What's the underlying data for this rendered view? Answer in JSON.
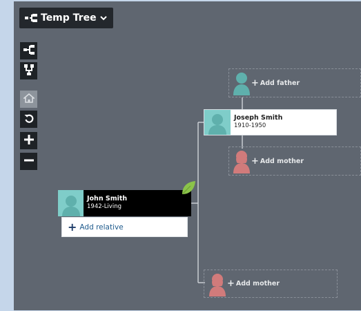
{
  "toolbar": {
    "tree_name": "Temp Tree",
    "tools": [
      {
        "name": "pedigree-view",
        "icon": "pedigree-icon"
      },
      {
        "name": "family-view",
        "icon": "family-view-icon"
      },
      {
        "name": "home",
        "icon": "home-icon"
      },
      {
        "name": "reset",
        "icon": "refresh-icon"
      },
      {
        "name": "zoom-in",
        "icon": "plus-icon"
      },
      {
        "name": "zoom-out",
        "icon": "minus-icon"
      }
    ]
  },
  "focus_person": {
    "name": "John Smith",
    "dates": "1942-Living",
    "add_relative_label": "Add relative"
  },
  "father": {
    "name": "Joseph Smith",
    "dates": "1910-1950"
  },
  "placeholders": {
    "add_father": "Add father",
    "add_mother_of_father": "Add mother",
    "add_mother": "Add mother"
  },
  "colors": {
    "canvas": "#5f6670",
    "male_avatar": "#5fb0ac",
    "female_avatar": "#d17b7b",
    "leaf_hint": "#8bc34a",
    "link_blue": "#1e5a8c"
  }
}
